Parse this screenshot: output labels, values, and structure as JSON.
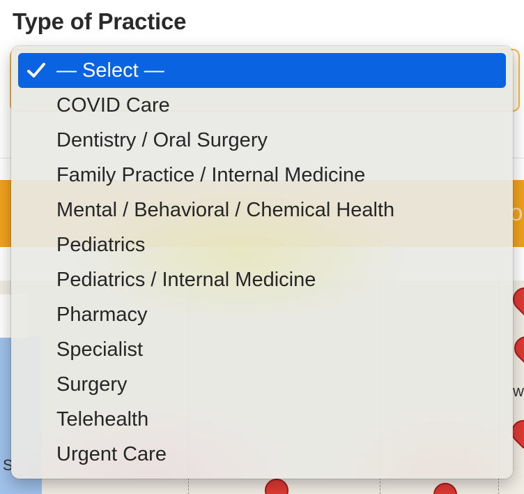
{
  "field": {
    "label": "Type of Practice"
  },
  "background": {
    "banner_edge_text": "ol",
    "map_label_w": "w",
    "map_label_s": "S"
  },
  "dropdown": {
    "selected_index": 0,
    "options": [
      {
        "label": "— Select —",
        "selected": true
      },
      {
        "label": "COVID Care",
        "selected": false
      },
      {
        "label": "Dentistry / Oral Surgery",
        "selected": false
      },
      {
        "label": "Family Practice / Internal Medicine",
        "selected": false
      },
      {
        "label": "Mental / Behavioral / Chemical Health",
        "selected": false
      },
      {
        "label": "Pediatrics",
        "selected": false
      },
      {
        "label": "Pediatrics / Internal Medicine",
        "selected": false
      },
      {
        "label": "Pharmacy",
        "selected": false
      },
      {
        "label": "Specialist",
        "selected": false
      },
      {
        "label": "Surgery",
        "selected": false
      },
      {
        "label": "Telehealth",
        "selected": false
      },
      {
        "label": "Urgent Care",
        "selected": false
      }
    ],
    "check_icon": "checkmark-icon"
  },
  "colors": {
    "selection": "#0a63e0",
    "banner": "#f0a21c",
    "select_border": "#f0b94a",
    "map_pin": "#e03a34"
  }
}
